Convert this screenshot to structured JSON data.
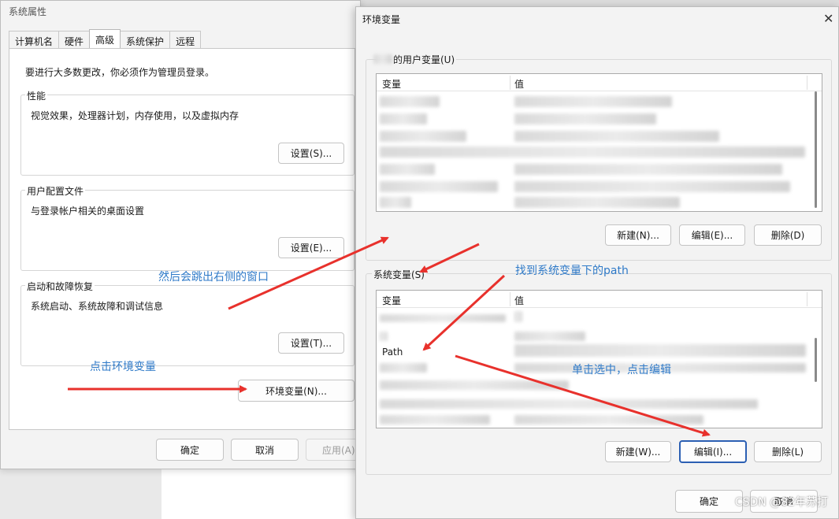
{
  "sysprops": {
    "title": "系统属性",
    "tabs": [
      "计算机名",
      "硬件",
      "高级",
      "系统保护",
      "远程"
    ],
    "admin_note": "要进行大多数更改，你必须作为管理员登录。",
    "performance": {
      "label": "性能",
      "desc": "视觉效果，处理器计划，内存使用，以及虚拟内存",
      "button": "设置(S)..."
    },
    "profiles": {
      "label": "用户配置文件",
      "desc": "与登录帐户相关的桌面设置",
      "button": "设置(E)..."
    },
    "startup": {
      "label": "启动和故障恢复",
      "desc": "系统启动、系统故障和调试信息",
      "button": "设置(T)..."
    },
    "env_button": "环境变量(N)...",
    "ok": "确定",
    "cancel": "取消",
    "apply": "应用(A)"
  },
  "envvars": {
    "title": "环境变量",
    "user_group_label": "的用户变量(U)",
    "user_col_var": "变量",
    "user_col_val": "值",
    "user_new": "新建(N)...",
    "user_edit": "编辑(E)...",
    "user_delete": "删除(D)",
    "sys_group_label": "系统变量(S)",
    "sys_col_var": "变量",
    "sys_col_val": "值",
    "sys_path_row": "Path",
    "sys_new": "新建(W)...",
    "sys_edit": "编辑(I)...",
    "sys_delete": "删除(L)",
    "ok": "确定",
    "cancel": "取消"
  },
  "annotations": {
    "then_popup": "然后会跳出右侧的窗口",
    "click_env": "点击环境变量",
    "find_path": "找到系统变量下的path",
    "select_edit": "单击选中，点击编辑"
  },
  "watermark": "CSDN @82年苏打",
  "colors": {
    "annotation_text": "#2f7ac8",
    "arrow": "#e8312c",
    "focus_border": "#2b5fb3"
  },
  "icons": {
    "close": "close-icon",
    "arrow": "red-arrow-icon"
  }
}
